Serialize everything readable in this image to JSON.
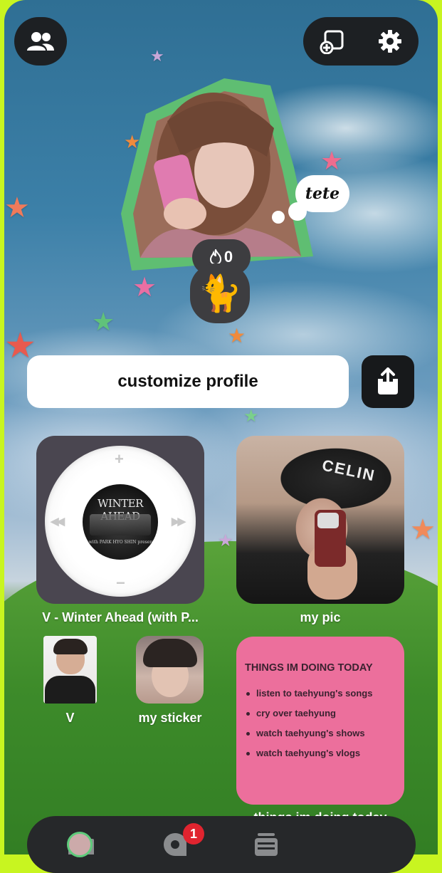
{
  "header": {
    "friends_icon": "friends-icon",
    "add_widget_icon": "add-widget-icon",
    "settings_icon": "gear-icon"
  },
  "profile": {
    "note": "tete",
    "streak_count": "0",
    "streak_icon": "flame-icon",
    "pet_emoji": "🐈"
  },
  "actions": {
    "customize_label": "customize profile",
    "share_icon": "share-icon"
  },
  "widgets": {
    "music": {
      "caption": "V - Winter Ahead (with P...",
      "album_title": "WINTER AHEAD",
      "album_sub": "V with PARK HYO SHIN presents"
    },
    "pic": {
      "caption": "my pic",
      "beanie_text": "CELIN"
    },
    "v_photo": {
      "caption": "V"
    },
    "sticker": {
      "caption": "my sticker"
    },
    "todo": {
      "title": "THINGS IM DOING TODAY",
      "items": [
        "listen to taehyung's songs",
        "cry over taehyung",
        "watch taehyung's shows",
        "watch taehyung's vlogs"
      ],
      "caption": "things im doing today"
    }
  },
  "navbar": {
    "items": [
      "camera-icon",
      "chat-icon",
      "feed-icon",
      "profile-avatar"
    ],
    "chat_badge": "1"
  },
  "colors": {
    "frame_accent": "#c8f520",
    "todo_bg": "#ec6f9c",
    "avatar_outline": "#5ecb7b",
    "badge": "#e0242f"
  }
}
